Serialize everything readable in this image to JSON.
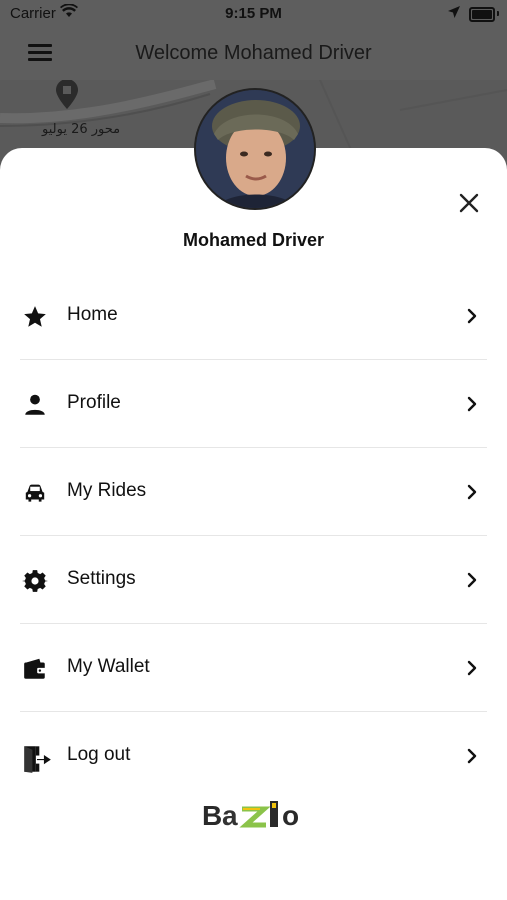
{
  "status": {
    "carrier": "Carrier",
    "time": "9:15 PM"
  },
  "header": {
    "title": "Welcome Mohamed Driver"
  },
  "map": {
    "street_label": "محور 26 يوليو"
  },
  "drawer": {
    "user_name": "Mohamed Driver",
    "items": [
      {
        "label": "Home",
        "icon": "star-icon"
      },
      {
        "label": "Profile",
        "icon": "person-icon"
      },
      {
        "label": "My Rides",
        "icon": "car-icon"
      },
      {
        "label": "Settings",
        "icon": "gear-icon"
      },
      {
        "label": "My Wallet",
        "icon": "wallet-icon"
      },
      {
        "label": "Log out",
        "icon": "logout-icon"
      }
    ]
  },
  "brand": {
    "logo_text": "Bazio"
  },
  "colors": {
    "overlay": "#5e5e5e",
    "sheet": "#ffffff",
    "text": "#111111",
    "logo_green": "#8bc34a",
    "logo_yellow": "#f1c40f"
  }
}
